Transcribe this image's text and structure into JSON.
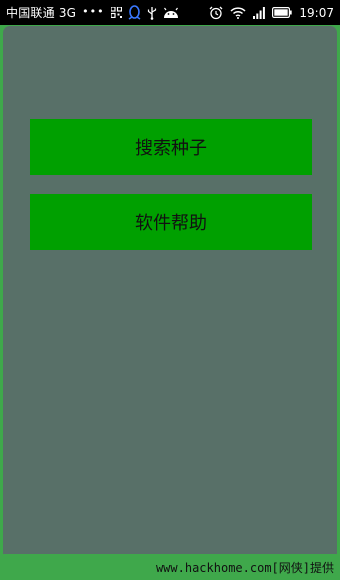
{
  "status_bar": {
    "carrier": "中国联通 3G",
    "overflow": "•••",
    "time": "19:07",
    "icons": [
      "app-grid-icon",
      "qq-penguin-icon",
      "usb-icon",
      "android-icon",
      "alarm-clock-icon",
      "wifi-icon",
      "signal-icon",
      "battery-icon"
    ]
  },
  "app": {
    "buttons": {
      "search_torrent": "搜索种子",
      "software_help": "软件帮助"
    },
    "colors": {
      "panel_bg": "#587068",
      "button_bg": "#00a000",
      "page_bg": "#3fa84b"
    }
  },
  "watermark": {
    "text": "www.hackhome.com[网侠]提供"
  }
}
